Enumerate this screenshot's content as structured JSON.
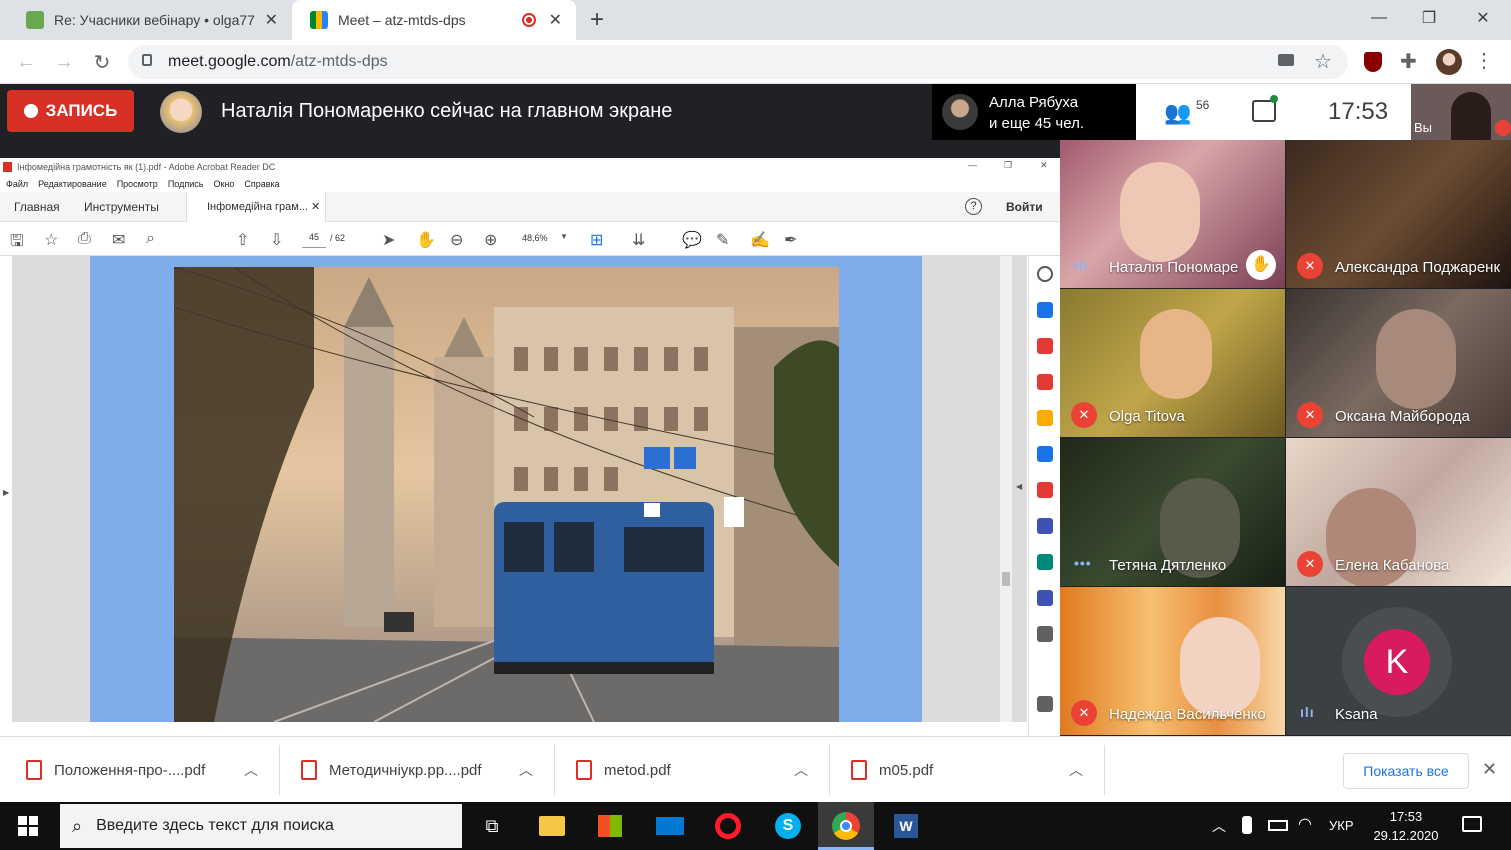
{
  "browser": {
    "tabs": [
      {
        "title": "Re: Учасники вебінару • olga77",
        "active": false
      },
      {
        "title": "Meet – atz-mtds-dps",
        "active": true
      }
    ],
    "url_host": "meet.google.com",
    "url_path": "/atz-mtds-dps"
  },
  "meet": {
    "record_label": "ЗАПИСЬ",
    "presenting_text": "Наталія Пономаренко сейчас на главном экране",
    "joined_line1": "Алла Рябуха",
    "joined_line2": "и еще 45 чел.",
    "participants_count": "56",
    "clock": "17:53",
    "self_label": "Вы",
    "tiles": [
      {
        "name": "Наталія Пономаренко",
        "muted": false,
        "hand": true
      },
      {
        "name": "Александра Поджаренко",
        "muted": true
      },
      {
        "name": "Olga Titova",
        "muted": true
      },
      {
        "name": "Оксана Майборода",
        "muted": true
      },
      {
        "name": "Тетяна Дятленко",
        "muted": false
      },
      {
        "name": "Елена Кабанова",
        "muted": true
      },
      {
        "name": "Надежда Васильченко",
        "muted": true
      },
      {
        "name": "Ksana",
        "muted": false,
        "initial": "K"
      }
    ]
  },
  "acrobat": {
    "title": "Інфомедійна грамотність як (1).pdf - Adobe Acrobat Reader DC",
    "menu": [
      "Файл",
      "Редактирование",
      "Просмотр",
      "Подпись",
      "Окно",
      "Справка"
    ],
    "tab_home": "Главная",
    "tab_tools": "Инструменты",
    "tab_doc": "Інфомедійна грам...",
    "signin": "Войти",
    "page_current": "45",
    "page_total": "/ 62",
    "zoom": "48,6%"
  },
  "downloads": {
    "items": [
      "Положення-про-....pdf",
      "Методичніукр.рр....pdf",
      "metod.pdf",
      "m05.pdf"
    ],
    "show_all": "Показать все"
  },
  "taskbar": {
    "search_placeholder": "Введите здесь текст для поиска",
    "lang": "УКР",
    "time": "17:53",
    "date": "29.12.2020"
  },
  "colors": {
    "record_red": "#d93025",
    "meet_dark": "#202124",
    "page_blue": "#7facea",
    "ksana_avatar": "#d81b60"
  }
}
